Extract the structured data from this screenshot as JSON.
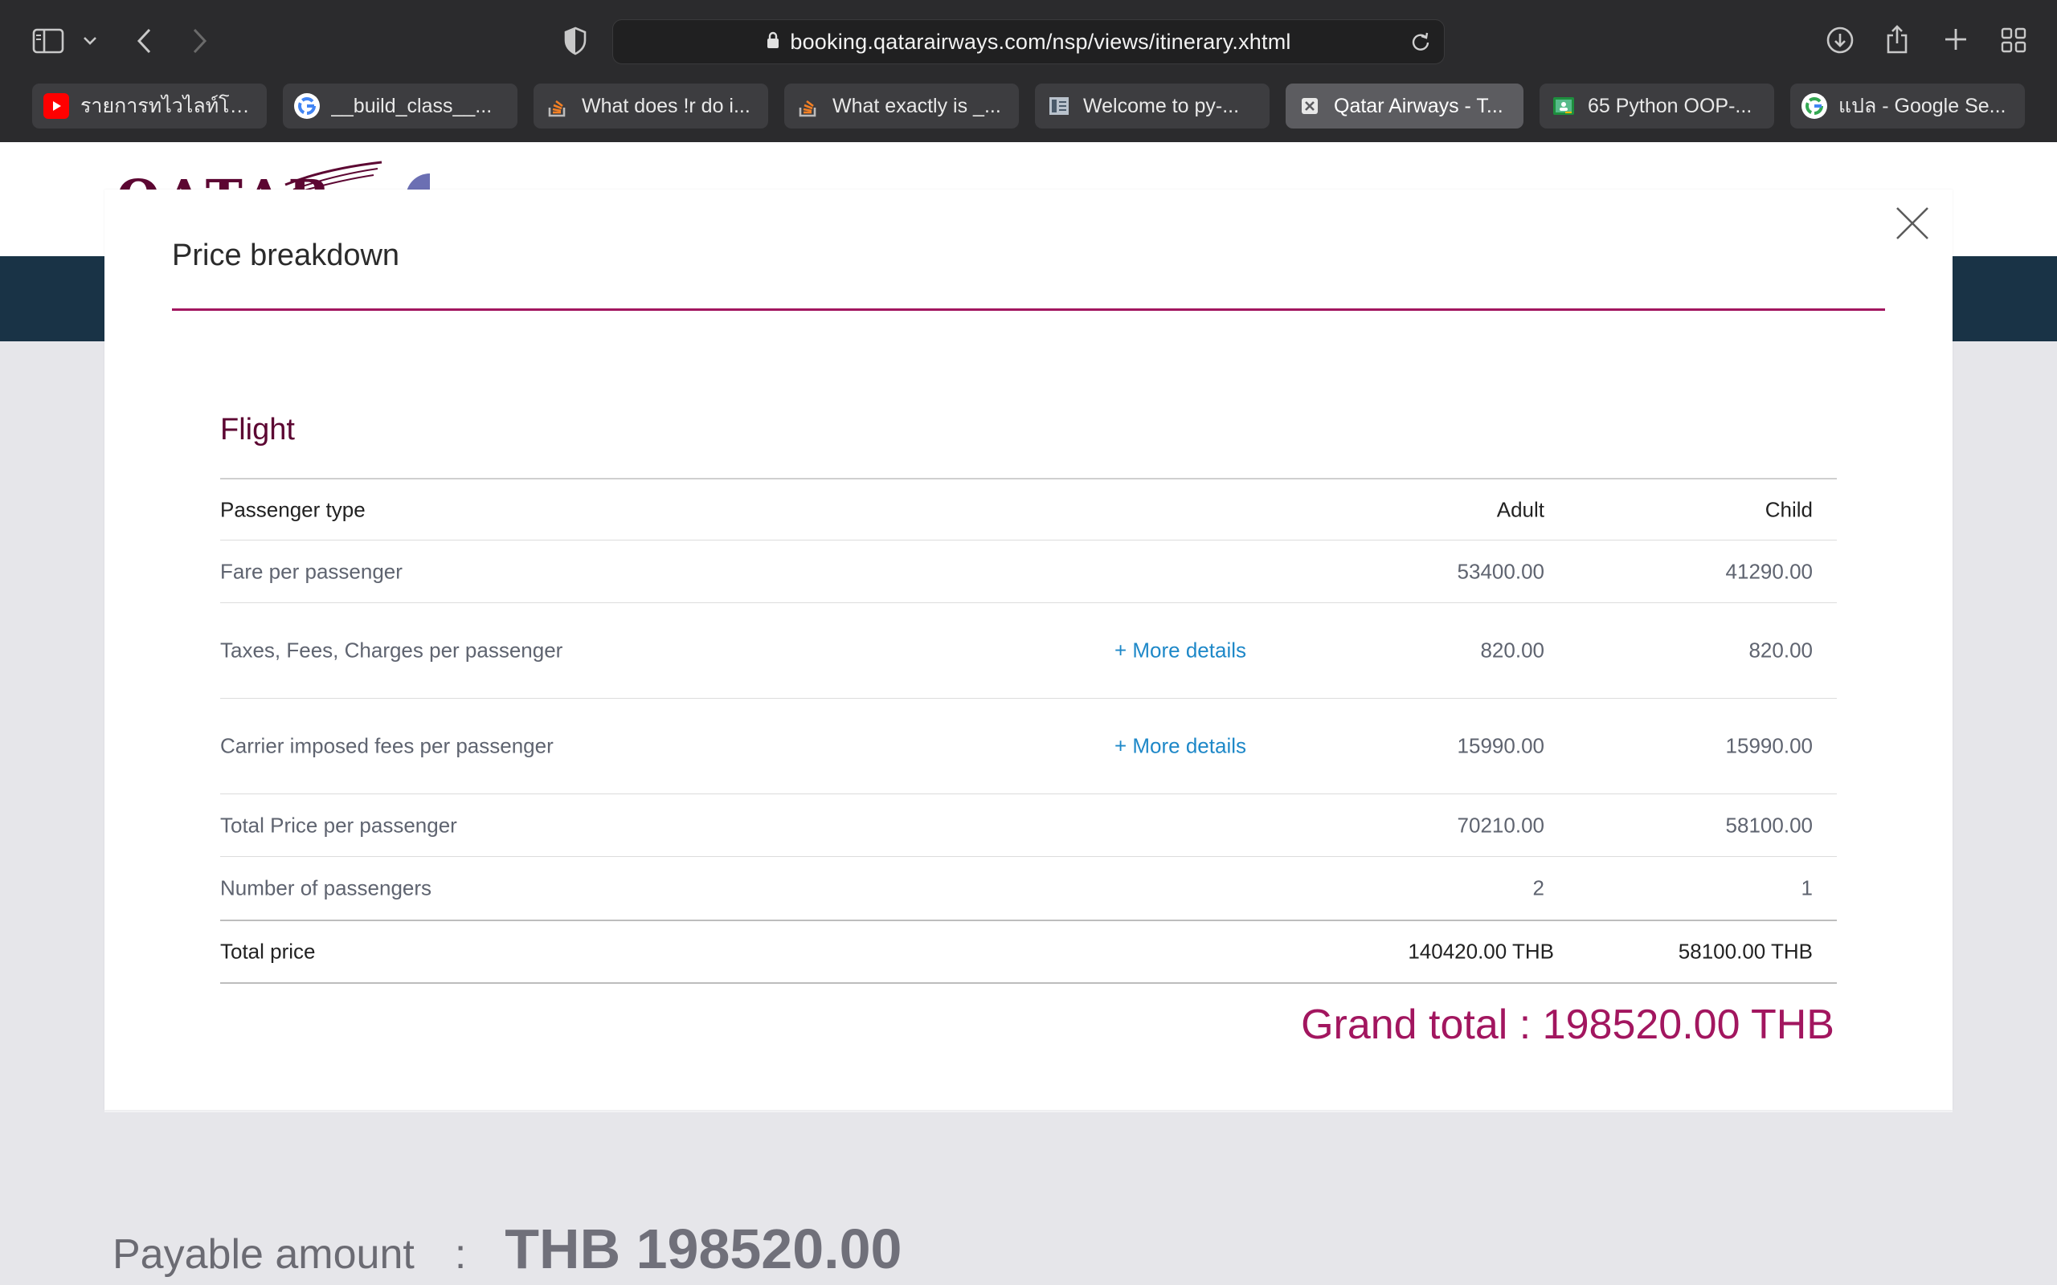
{
  "browser": {
    "url": "booking.qatarairways.com/nsp/views/itinerary.xhtml",
    "tabs": [
      {
        "title": "รายการทไวไลท์โชว์...",
        "favicon": "youtube-icon",
        "active": false
      },
      {
        "title": "__build_class__...",
        "favicon": "google-icon",
        "active": false
      },
      {
        "title": "What does !r do i...",
        "favicon": "stackoverflow-icon",
        "active": false
      },
      {
        "title": "What exactly is _...",
        "favicon": "stackoverflow-icon",
        "active": false
      },
      {
        "title": "Welcome to py-...",
        "favicon": "docs-icon",
        "active": false
      },
      {
        "title": "Qatar Airways - T...",
        "favicon": "close-tab-icon",
        "active": true
      },
      {
        "title": "65 Python OOP-...",
        "favicon": "classroom-icon",
        "active": false
      },
      {
        "title": "แปล - Google Se...",
        "favicon": "google-icon",
        "active": false
      }
    ]
  },
  "brand": {
    "logo_text": "QATAR",
    "color": "#5c0632",
    "accent": "#a2165f"
  },
  "modal": {
    "title": "Price breakdown",
    "section_title": "Flight",
    "columns": {
      "label": "Passenger type",
      "adult": "Adult",
      "child": "Child"
    },
    "rows": [
      {
        "label": "Fare per passenger",
        "link": "",
        "adult": "53400.00",
        "child": "41290.00"
      },
      {
        "label": "Taxes, Fees, Charges per passenger",
        "link": "+ More details",
        "adult": "820.00",
        "child": "820.00"
      },
      {
        "label": "Carrier imposed fees per passenger",
        "link": "+ More details",
        "adult": "15990.00",
        "child": "15990.00"
      },
      {
        "label": "Total Price per passenger",
        "link": "",
        "adult": "70210.00",
        "child": "58100.00"
      },
      {
        "label": "Number of passengers",
        "link": "",
        "adult": "2",
        "child": "1"
      }
    ],
    "total": {
      "label": "Total price",
      "adult": "140420.00 THB",
      "child": "58100.00 THB"
    },
    "grand_total": "Grand total : 198520.00 THB"
  },
  "payable": {
    "label": "Payable amount",
    "colon": ":",
    "amount": "THB 198520.00"
  }
}
